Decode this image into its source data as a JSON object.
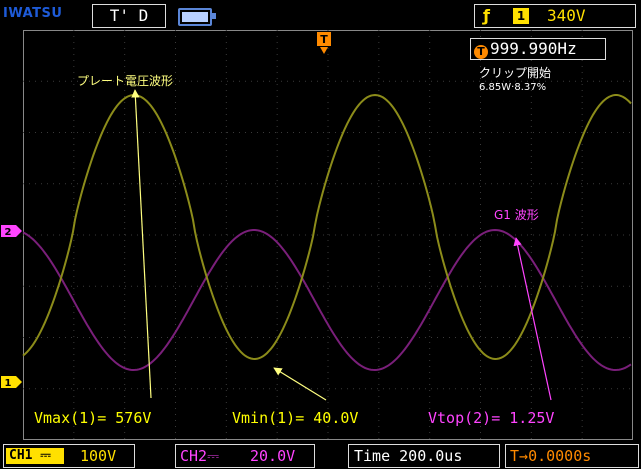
{
  "header": {
    "brand": "IWATSU",
    "acq_state": "T' D",
    "trigger_channel": "1",
    "trigger_level": "340V",
    "battery_icon": "battery-icon",
    "edge_icon": "rising-edge-icon"
  },
  "frequency": "999.990Hz",
  "notes": {
    "clip_start": "クリップ開始",
    "clip_values": "6.85W·8.37%"
  },
  "labels": {
    "plate": "プレート電圧波形",
    "g1": "G1 波形"
  },
  "measurements": {
    "vmax": "Vmax(1)= 576V",
    "vmin": "Vmin(1)= 40.0V",
    "vtop": "Vtop(2)= 1.25V"
  },
  "footer": {
    "ch1_tag": "CH1",
    "ch1_scale": "100V",
    "ch2_tag": "CH2",
    "ch2_scale": "20.0V",
    "timebase": "Time 200.0us",
    "trigger_pos": "0.0000s"
  },
  "markers": {
    "ch1": "1",
    "ch2": "2",
    "trigger": "T"
  },
  "colors": {
    "ch1_trace": "#8c8c1a",
    "ch2_trace": "#7a1f7a",
    "ch1": "#ffe000",
    "ch2": "#ff44ff",
    "brand": "#1e5bd8",
    "trigger_pos": "#ff8a00"
  }
}
